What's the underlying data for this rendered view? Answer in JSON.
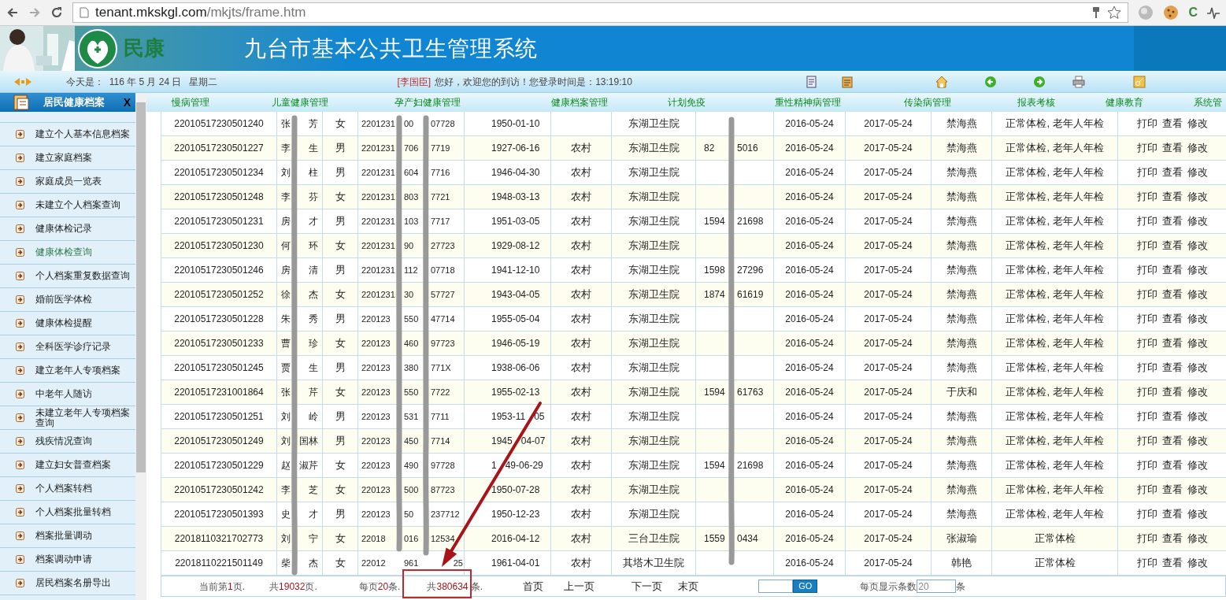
{
  "browser": {
    "url_host": "tenant.mkskgl.com",
    "url_path": "/mkjts/frame.htm",
    "extension_letter": "C"
  },
  "banner": {
    "logo_text": "民康",
    "title": "九台市基本公共卫生管理系统"
  },
  "info_bar": {
    "date_label": "今天是：",
    "date": "116 年 5 月 24 日",
    "weekday": "星期二",
    "user": "[李国臣]",
    "greeting": "您好，欢迎您的到访！您登录时间是：13:19:10"
  },
  "sidebar": {
    "title": "居民健康档案",
    "close": "X",
    "items": [
      {
        "label": "建立个人基本信息档案",
        "selected": false
      },
      {
        "label": "建立家庭档案",
        "selected": false
      },
      {
        "label": "家庭成员一览表",
        "selected": false
      },
      {
        "label": "未建立个人档案查询",
        "selected": false
      },
      {
        "label": "健康体检记录",
        "selected": false
      },
      {
        "label": "健康体检查询",
        "selected": true
      },
      {
        "label": "个人档案重复数据查询",
        "selected": false
      },
      {
        "label": "婚前医学体检",
        "selected": false
      },
      {
        "label": "健康体检提醒",
        "selected": false
      },
      {
        "label": "全科医学诊疗记录",
        "selected": false
      },
      {
        "label": "建立老年人专项档案",
        "selected": false
      },
      {
        "label": "中老年人随访",
        "selected": false
      },
      {
        "label": "未建立老年人专项档案查询",
        "selected": false
      },
      {
        "label": "残疾情况查询",
        "selected": false
      },
      {
        "label": "建立妇女普查档案",
        "selected": false
      },
      {
        "label": "个人档案转档",
        "selected": false
      },
      {
        "label": "个人档案批量转档",
        "selected": false
      },
      {
        "label": "档案批量调动",
        "selected": false
      },
      {
        "label": "档案调动申请",
        "selected": false
      },
      {
        "label": "居民档案名册导出",
        "selected": false
      }
    ]
  },
  "nav": [
    "慢病管理",
    "儿童健康管理",
    "孕产妇健康管理",
    "健康档案管理",
    "计划免疫",
    "重性精神病管理",
    "传染病管理",
    "报表考核",
    "健康教育",
    "系统管"
  ],
  "table": {
    "rows": [
      {
        "id": "22010517230501240",
        "name": [
          "张",
          "芳"
        ],
        "sex": "女",
        "idcard": [
          "2201231",
          "00",
          "07728"
        ],
        "birth": "1950-01-10",
        "hospital": "东湖卫生院",
        "created": "2016-05-24",
        "due": "2017-05-24",
        "doctor": "禁海燕",
        "check_type": "正常体检, 老年人年检",
        "actions": [
          "打印",
          "查看",
          "修改"
        ]
      },
      {
        "id": "22010517230501227",
        "name": [
          "李",
          "生"
        ],
        "sex": "男",
        "idcard": [
          "2201231",
          "706",
          "7719"
        ],
        "birth": "1927-06-16",
        "area": "农村",
        "hospital": "东湖卫生院",
        "phone": [
          "82",
          "5016"
        ],
        "created": "2016-05-24",
        "due": "2017-05-24",
        "doctor": "禁海燕",
        "check_type": "正常体检, 老年人年检",
        "actions": [
          "打印",
          "查看",
          "修改"
        ]
      },
      {
        "id": "22010517230501234",
        "name": [
          "刘",
          "柱"
        ],
        "sex": "男",
        "idcard": [
          "2201231",
          "604",
          "7716"
        ],
        "birth": "1946-04-30",
        "area": "农村",
        "hospital": "东湖卫生院",
        "created": "2016-05-24",
        "due": "2017-05-24",
        "doctor": "禁海燕",
        "check_type": "正常体检, 老年人年检",
        "actions": [
          "打印",
          "查看",
          "修改"
        ]
      },
      {
        "id": "22010517230501248",
        "name": [
          "李",
          "芬"
        ],
        "sex": "女",
        "idcard": [
          "2201231",
          "803",
          "7721"
        ],
        "birth": "1948-03-13",
        "area": "农村",
        "hospital": "东湖卫生院",
        "created": "2016-05-24",
        "due": "2017-05-24",
        "doctor": "禁海燕",
        "check_type": "正常体检, 老年人年检",
        "actions": [
          "打印",
          "查看",
          "修改"
        ]
      },
      {
        "id": "22010517230501231",
        "name": [
          "房",
          "才"
        ],
        "sex": "男",
        "idcard": [
          "2201231",
          "103",
          "7717"
        ],
        "birth": "1951-03-05",
        "area": "农村",
        "hospital": "东湖卫生院",
        "phone": [
          "1594",
          "21698"
        ],
        "created": "2016-05-24",
        "due": "2017-05-24",
        "doctor": "禁海燕",
        "check_type": "正常体检, 老年人年检",
        "actions": [
          "打印",
          "查看",
          "修改"
        ]
      },
      {
        "id": "22010517230501230",
        "name": [
          "何",
          "环"
        ],
        "sex": "女",
        "idcard": [
          "2201231",
          "90",
          "27723"
        ],
        "birth": "1929-08-12",
        "area": "农村",
        "hospital": "东湖卫生院",
        "created": "2016-05-24",
        "due": "2017-05-24",
        "doctor": "禁海燕",
        "check_type": "正常体检, 老年人年检",
        "actions": [
          "打印",
          "查看",
          "修改"
        ]
      },
      {
        "id": "22010517230501246",
        "name": [
          "房",
          "清"
        ],
        "sex": "男",
        "idcard": [
          "2201231",
          "112",
          "07718"
        ],
        "birth": "1941-12-10",
        "area": "农村",
        "hospital": "东湖卫生院",
        "phone": [
          "1598",
          "27296"
        ],
        "created": "2016-05-24",
        "due": "2017-05-24",
        "doctor": "禁海燕",
        "check_type": "正常体检, 老年人年检",
        "actions": [
          "打印",
          "查看",
          "修改"
        ]
      },
      {
        "id": "22010517230501252",
        "name": [
          "徐",
          "杰"
        ],
        "sex": "女",
        "idcard": [
          "2201231",
          "30",
          "57727"
        ],
        "birth": "1943-04-05",
        "area": "农村",
        "hospital": "东湖卫生院",
        "phone": [
          "1874",
          "61619"
        ],
        "created": "2016-05-24",
        "due": "2017-05-24",
        "doctor": "禁海燕",
        "check_type": "正常体检, 老年人年检",
        "actions": [
          "打印",
          "查看",
          "修改"
        ]
      },
      {
        "id": "22010517230501228",
        "name": [
          "朱",
          "秀"
        ],
        "sex": "男",
        "idcard": [
          "220123",
          "550",
          "47714"
        ],
        "birth": "1955-05-04",
        "area": "农村",
        "hospital": "东湖卫生院",
        "created": "2016-05-24",
        "due": "2017-05-24",
        "doctor": "禁海燕",
        "check_type": "正常体检, 老年人年检",
        "actions": [
          "打印",
          "查看",
          "修改"
        ]
      },
      {
        "id": "22010517230501233",
        "name": [
          "曹",
          "珍"
        ],
        "sex": "女",
        "idcard": [
          "220123",
          "460",
          "97723"
        ],
        "birth": "1946-05-19",
        "area": "农村",
        "hospital": "东湖卫生院",
        "created": "2016-05-24",
        "due": "2017-05-24",
        "doctor": "禁海燕",
        "check_type": "正常体检, 老年人年检",
        "actions": [
          "打印",
          "查看",
          "修改"
        ]
      },
      {
        "id": "22010517230501245",
        "name": [
          "贾",
          "生"
        ],
        "sex": "男",
        "idcard": [
          "220123",
          "380",
          "771X"
        ],
        "birth": "1938-06-06",
        "area": "农村",
        "hospital": "东湖卫生院",
        "created": "2016-05-24",
        "due": "2017-05-24",
        "doctor": "禁海燕",
        "check_type": "正常体检, 老年人年检",
        "actions": [
          "打印",
          "查看",
          "修改"
        ]
      },
      {
        "id": "22010517231001864",
        "name": [
          "张",
          "芹"
        ],
        "sex": "女",
        "idcard": [
          "220123",
          "550",
          "7722"
        ],
        "birth": "1955-02-13",
        "area": "农村",
        "hospital": "东湖卫生院",
        "phone": [
          "1594",
          "61763"
        ],
        "created": "2016-05-24",
        "due": "2017-05-24",
        "doctor": "于庆和",
        "check_type": "正常体检, 老年人年检",
        "actions": [
          "打印",
          "查看",
          "修改"
        ]
      },
      {
        "id": "22010517230501251",
        "name": [
          "刘",
          "岭"
        ],
        "sex": "男",
        "idcard": [
          "220123",
          "531",
          "7711"
        ],
        "birth": [
          "1953-11",
          "05"
        ],
        "area": "农村",
        "hospital": "东湖卫生院",
        "created": "2016-05-24",
        "due": "2017-05-24",
        "doctor": "禁海燕",
        "check_type": "正常体检, 老年人年检",
        "actions": [
          "打印",
          "查看",
          "修改"
        ]
      },
      {
        "id": "22010517230501249",
        "name": [
          "刘",
          "国林"
        ],
        "sex": "男",
        "idcard": [
          "220123",
          "450",
          "7714"
        ],
        "birth": [
          "1945",
          "04-07"
        ],
        "area": "农村",
        "hospital": "东湖卫生院",
        "created": "2016-05-24",
        "due": "2017-05-24",
        "doctor": "禁海燕",
        "check_type": "正常体检, 老年人年检",
        "actions": [
          "打印",
          "查看",
          "修改"
        ]
      },
      {
        "id": "22010517230501229",
        "name": [
          "赵",
          "淑芹"
        ],
        "sex": "女",
        "idcard": [
          "220123",
          "490",
          "97728"
        ],
        "birth": [
          "1",
          "49-06-29"
        ],
        "area": "农村",
        "hospital": "东湖卫生院",
        "phone": [
          "1594",
          "21698"
        ],
        "created": "2016-05-24",
        "due": "2017-05-24",
        "doctor": "禁海燕",
        "check_type": "正常体检, 老年人年检",
        "actions": [
          "打印",
          "查看",
          "修改"
        ]
      },
      {
        "id": "22010517230501242",
        "name": [
          "李",
          "芝"
        ],
        "sex": "女",
        "idcard": [
          "220123",
          "500",
          "87723"
        ],
        "birth": "1950-07-28",
        "area": "农村",
        "hospital": "东湖卫生院",
        "created": "2016-05-24",
        "due": "2017-05-24",
        "doctor": "禁海燕",
        "check_type": "正常体检, 老年人年检",
        "actions": [
          "打印",
          "查看",
          "修改"
        ]
      },
      {
        "id": "22010517230501393",
        "name": [
          "史",
          "才"
        ],
        "sex": "男",
        "idcard": [
          "220123",
          "50",
          "237712"
        ],
        "birth": "1950-12-23",
        "area": "农村",
        "hospital": "东湖卫生院",
        "created": "2016-05-24",
        "due": "2017-05-24",
        "doctor": "禁海燕",
        "check_type": "正常体检, 老年人年检",
        "actions": [
          "打印",
          "查看",
          "修改"
        ]
      },
      {
        "id": "22018110321702773",
        "name": [
          "刘",
          "宁"
        ],
        "sex": "女",
        "idcard": [
          "22018",
          "016",
          "12534"
        ],
        "birth": "2016-04-12",
        "area": "农村",
        "hospital": "三台卫生院",
        "phone": [
          "1559",
          "0434"
        ],
        "created": "2016-05-24",
        "due": "2017-05-24",
        "doctor": "张淑瑜",
        "check_type": "正常体检",
        "actions": [
          "打印",
          "查看",
          "修改"
        ]
      },
      {
        "id": "22018110221501149",
        "name": [
          "柴",
          "杰"
        ],
        "sex": "女",
        "idcard": [
          "22012",
          "961",
          "25"
        ],
        "birth": "1961-04-01",
        "area": "农村",
        "hospital": "其塔木卫生院",
        "created": "2016-05-24",
        "due": "2017-05-24",
        "doctor": "韩艳",
        "check_type": "正常体检",
        "actions": [
          "打印",
          "查看",
          "修改"
        ]
      }
    ]
  },
  "pager": {
    "current": [
      {
        "text": "当前第"
      },
      {
        "text": "1",
        "highlight": true
      },
      {
        "text": "页."
      }
    ],
    "pages": [
      {
        "text": "共"
      },
      {
        "text": "19032",
        "highlight": true
      },
      {
        "text": "页."
      }
    ],
    "per_page": [
      {
        "text": "每页"
      },
      {
        "text": "20",
        "highlight": true
      },
      {
        "text": "条."
      }
    ],
    "total": [
      {
        "text": "共"
      },
      {
        "text": "380634",
        "highlight": true
      },
      {
        "text": " 条."
      }
    ],
    "links": [
      "首页",
      "上一页",
      "下一页",
      "末页"
    ],
    "go": "GO",
    "size_label": "每页显示条数",
    "size_value": "20",
    "size_unit": "条"
  }
}
